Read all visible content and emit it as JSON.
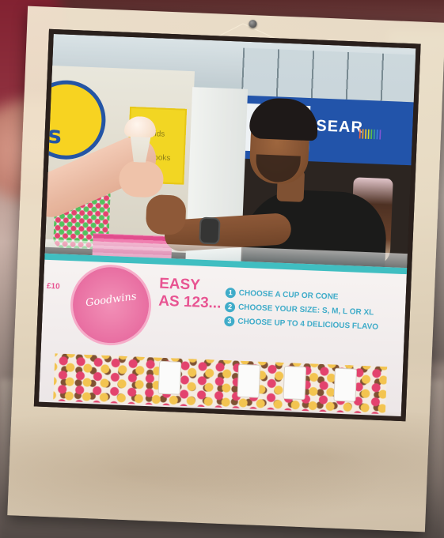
{
  "image": {
    "alt": "Framed photo of an ice cream vendor handing a cone to a customer over a counter"
  },
  "scene": {
    "logo_text": "ts",
    "yellow_sign_lines": [
      "Kids",
      "Books"
    ],
    "blue_sign_text": "SEAR",
    "rainbow_text": "||||||||",
    "badge_text": "Goodwins",
    "easy_text": [
      "EASY",
      "AS 123..."
    ],
    "price_text": "£10",
    "steps": [
      {
        "num": "1",
        "text": "CHOOSE A CUP OR CONE"
      },
      {
        "num": "2",
        "text": "CHOOSE YOUR SIZE: S, M, L OR XL"
      },
      {
        "num": "3",
        "text": "CHOOSE UP TO 4 DELICIOUS FLAVO"
      }
    ]
  }
}
